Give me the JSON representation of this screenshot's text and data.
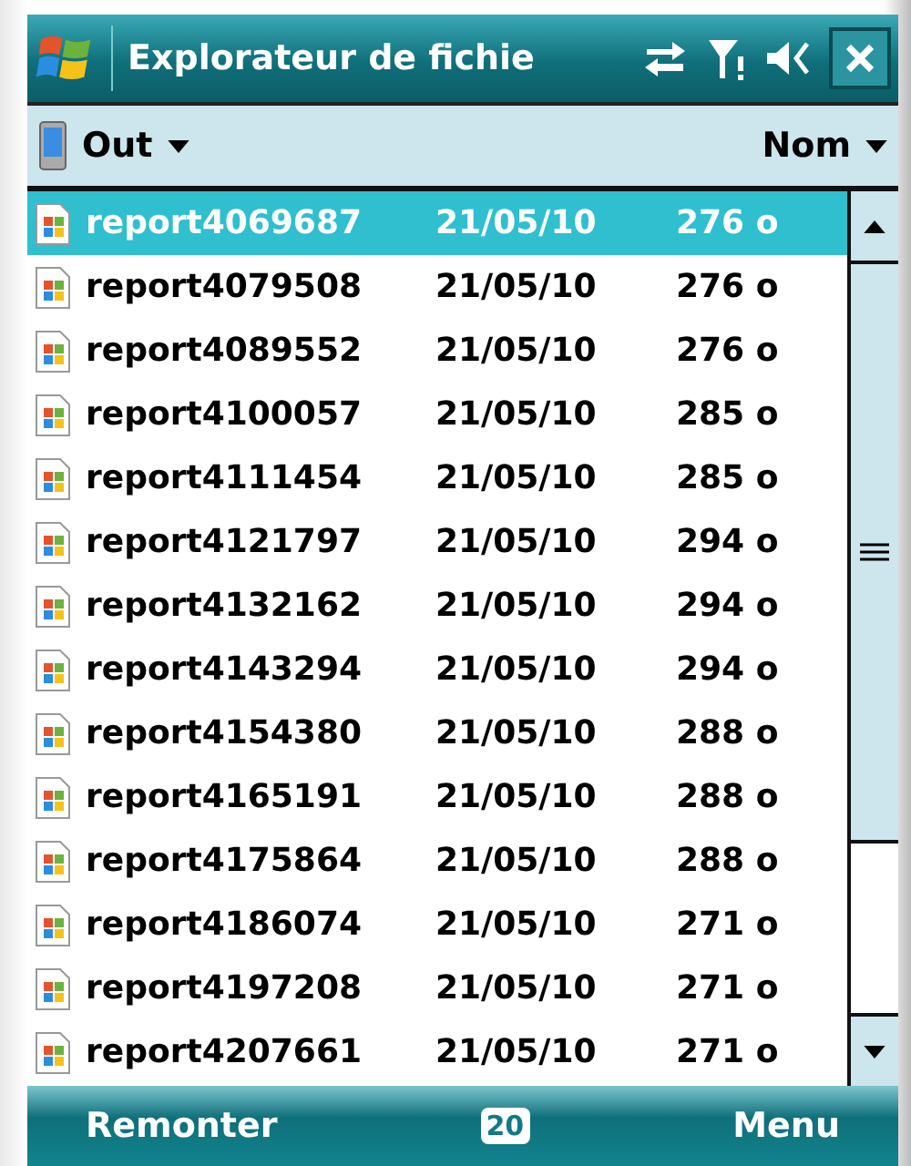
{
  "window": {
    "title": "Explorateur de fichie"
  },
  "toolbar": {
    "folder": "Out",
    "sort": "Nom"
  },
  "files": [
    {
      "name": "report4069687",
      "date": "21/05/10",
      "size": "276 o",
      "selected": true
    },
    {
      "name": "report4079508",
      "date": "21/05/10",
      "size": "276 o",
      "selected": false
    },
    {
      "name": "report4089552",
      "date": "21/05/10",
      "size": "276 o",
      "selected": false
    },
    {
      "name": "report4100057",
      "date": "21/05/10",
      "size": "285 o",
      "selected": false
    },
    {
      "name": "report4111454",
      "date": "21/05/10",
      "size": "285 o",
      "selected": false
    },
    {
      "name": "report4121797",
      "date": "21/05/10",
      "size": "294 o",
      "selected": false
    },
    {
      "name": "report4132162",
      "date": "21/05/10",
      "size": "294 o",
      "selected": false
    },
    {
      "name": "report4143294",
      "date": "21/05/10",
      "size": "294 o",
      "selected": false
    },
    {
      "name": "report4154380",
      "date": "21/05/10",
      "size": "288 o",
      "selected": false
    },
    {
      "name": "report4165191",
      "date": "21/05/10",
      "size": "288 o",
      "selected": false
    },
    {
      "name": "report4175864",
      "date": "21/05/10",
      "size": "288 o",
      "selected": false
    },
    {
      "name": "report4186074",
      "date": "21/05/10",
      "size": "271 o",
      "selected": false
    },
    {
      "name": "report4197208",
      "date": "21/05/10",
      "size": "271 o",
      "selected": false
    },
    {
      "name": "report4207661",
      "date": "21/05/10",
      "size": "271 o",
      "selected": false
    }
  ],
  "softkeys": {
    "left": "Remonter",
    "badge": "20",
    "right": "Menu"
  }
}
